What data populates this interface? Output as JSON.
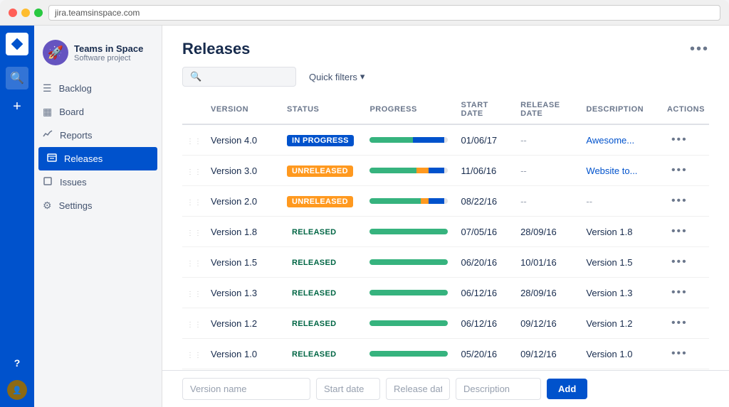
{
  "browser": {
    "url": "jira.teamsinspace.com"
  },
  "rail": {
    "logo_icon": "◆",
    "items": [
      {
        "icon": "🔍",
        "name": "search",
        "label": "Search"
      },
      {
        "icon": "+",
        "name": "create",
        "label": "Create"
      }
    ],
    "bottom": [
      {
        "icon": "?",
        "name": "help",
        "label": "Help"
      }
    ]
  },
  "project": {
    "name": "Teams in Space",
    "type": "Software project",
    "avatar_emoji": "🚀"
  },
  "nav": {
    "items": [
      {
        "id": "backlog",
        "label": "Backlog",
        "icon": "☰"
      },
      {
        "id": "board",
        "label": "Board",
        "icon": "▦"
      },
      {
        "id": "reports",
        "label": "Reports",
        "icon": "📈"
      },
      {
        "id": "releases",
        "label": "Releases",
        "icon": "📋",
        "active": true
      },
      {
        "id": "issues",
        "label": "Issues",
        "icon": "◻"
      },
      {
        "id": "settings",
        "label": "Settings",
        "icon": "⚙"
      }
    ]
  },
  "page": {
    "title": "Releases",
    "more_btn": "•••"
  },
  "toolbar": {
    "search_placeholder": "",
    "filter_label": "Quick filters",
    "filter_icon": "▾"
  },
  "table": {
    "columns": [
      "",
      "Version",
      "Status",
      "Progress",
      "Start date",
      "Release date",
      "Description",
      "Actions"
    ],
    "rows": [
      {
        "id": "v4",
        "version": "Version 4.0",
        "status": "IN PROGRESS",
        "status_type": "inprogress",
        "progress": [
          {
            "type": "done",
            "pct": 55
          },
          {
            "type": "inprog",
            "pct": 40
          },
          {
            "type": "none",
            "pct": 5
          }
        ],
        "start_date": "01/06/17",
        "release_date": "--",
        "description": "Awesome...",
        "actions": "•••"
      },
      {
        "id": "v3",
        "version": "Version 3.0",
        "status": "UNRELEASED",
        "status_type": "unreleased",
        "progress": [
          {
            "type": "done",
            "pct": 60
          },
          {
            "type": "yellow",
            "pct": 15
          },
          {
            "type": "inprog",
            "pct": 20
          },
          {
            "type": "none",
            "pct": 5
          }
        ],
        "start_date": "11/06/16",
        "release_date": "--",
        "description": "Website to...",
        "actions": "•••"
      },
      {
        "id": "v2",
        "version": "Version 2.0",
        "status": "UNRELEASED",
        "status_type": "unreleased",
        "progress": [
          {
            "type": "done",
            "pct": 65
          },
          {
            "type": "yellow",
            "pct": 10
          },
          {
            "type": "inprog",
            "pct": 20
          },
          {
            "type": "none",
            "pct": 5
          }
        ],
        "start_date": "08/22/16",
        "release_date": "--",
        "description": "--",
        "actions": "•••"
      },
      {
        "id": "v18",
        "version": "Version 1.8",
        "status": "RELEASED",
        "status_type": "released",
        "progress": [
          {
            "type": "done",
            "pct": 100
          }
        ],
        "start_date": "07/05/16",
        "release_date": "28/09/16",
        "description": "Version 1.8",
        "actions": "•••"
      },
      {
        "id": "v15",
        "version": "Version 1.5",
        "status": "RELEASED",
        "status_type": "released",
        "progress": [
          {
            "type": "done",
            "pct": 100
          }
        ],
        "start_date": "06/20/16",
        "release_date": "10/01/16",
        "description": "Version 1.5",
        "actions": "•••"
      },
      {
        "id": "v13",
        "version": "Version 1.3",
        "status": "RELEASED",
        "status_type": "released",
        "progress": [
          {
            "type": "done",
            "pct": 100
          }
        ],
        "start_date": "06/12/16",
        "release_date": "28/09/16",
        "description": "Version 1.3",
        "actions": "•••"
      },
      {
        "id": "v12",
        "version": "Version 1.2",
        "status": "RELEASED",
        "status_type": "released",
        "progress": [
          {
            "type": "done",
            "pct": 100
          }
        ],
        "start_date": "06/12/16",
        "release_date": "09/12/16",
        "description": "Version 1.2",
        "actions": "•••"
      },
      {
        "id": "v10",
        "version": "Version 1.0",
        "status": "RELEASED",
        "status_type": "released",
        "progress": [
          {
            "type": "done",
            "pct": 100
          }
        ],
        "start_date": "05/20/16",
        "release_date": "09/12/16",
        "description": "Version 1.0",
        "actions": "•••"
      }
    ]
  },
  "add_row": {
    "version_placeholder": "Version name",
    "start_placeholder": "Start date",
    "release_placeholder": "Release date",
    "desc_placeholder": "Description",
    "add_label": "Add"
  }
}
